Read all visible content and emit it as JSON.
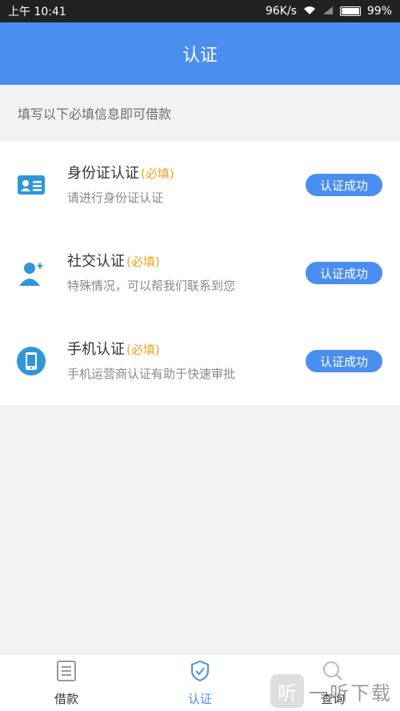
{
  "status_bar": {
    "time": "上午 10:41",
    "net_speed": "96K/s",
    "battery_pct": "99%"
  },
  "header": {
    "title": "认证"
  },
  "subtitle": "填写以下必填信息即可借款",
  "items": [
    {
      "title": "身份证认证",
      "required": "(必填)",
      "desc": "请进行身份证认证",
      "status": "认证成功",
      "icon": "id-card-icon"
    },
    {
      "title": "社交认证",
      "required": "(必填)",
      "desc": "特殊情况，可以帮我们联系到您",
      "status": "认证成功",
      "icon": "social-user-icon"
    },
    {
      "title": "手机认证",
      "required": "(必填)",
      "desc": "手机运营商认证有助于快速审批",
      "status": "认证成功",
      "icon": "phone-icon"
    }
  ],
  "tabs": [
    {
      "label": "借款",
      "icon": "document-icon"
    },
    {
      "label": "认证",
      "icon": "shield-check-icon"
    },
    {
      "label": "查询",
      "icon": "search-icon"
    }
  ],
  "watermark": {
    "logo_char": "听",
    "text": "一听下载"
  },
  "colors": {
    "primary": "#4a8ff0",
    "required": "#f0a020"
  }
}
